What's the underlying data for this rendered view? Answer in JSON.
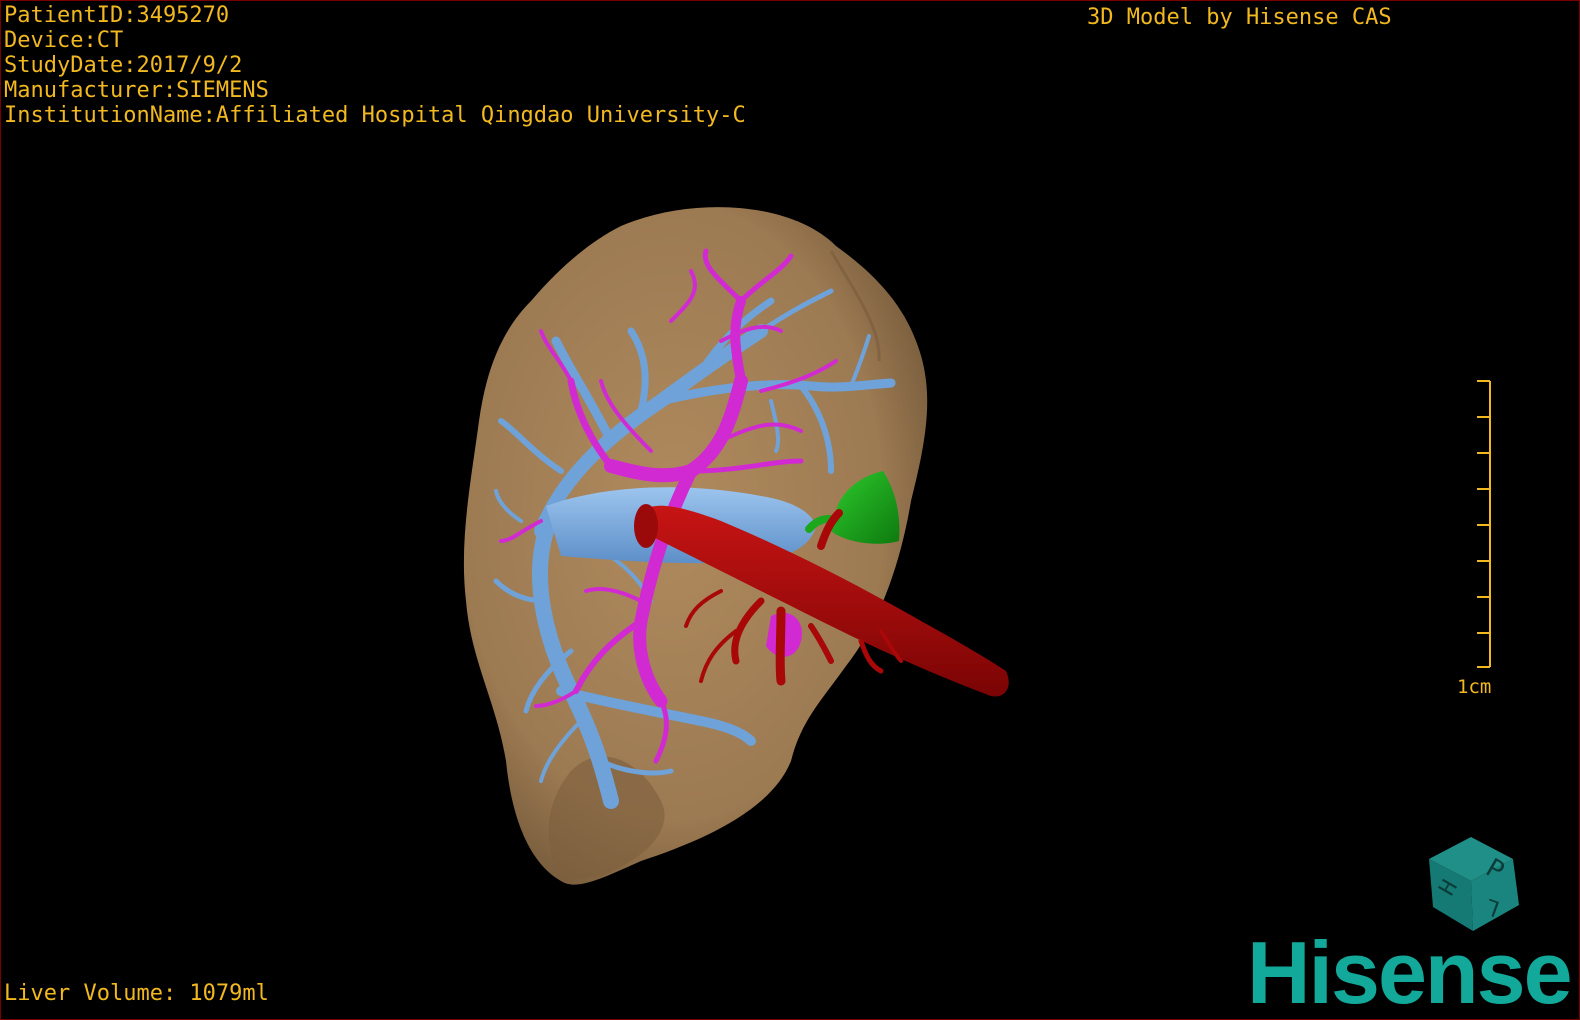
{
  "overlay": {
    "patient_id": "PatientID:3495270",
    "device": "Device:CT",
    "study_date": "StudyDate:2017/9/2",
    "manufacturer": "Manufacturer:SIEMENS",
    "institution": "InstitutionName:Affiliated Hospital Qingdao University-C",
    "credit": "3D Model by Hisense CAS",
    "liver_volume": "Liver Volume: 1079ml"
  },
  "scale_bar": {
    "label": "1cm"
  },
  "orientation_cube": {
    "letters": [
      "P",
      "H",
      "L"
    ]
  },
  "brand": {
    "logo_text": "Hisense"
  },
  "colors": {
    "text": "#f2b820",
    "liver": "#a07c52",
    "portal_vein": "#6fa2d8",
    "hepatic_vein": "#d22ad2",
    "artery": "#b00808",
    "gallbladder": "#1ca81c",
    "brand": "#12a89a"
  },
  "icons": [
    "orientation-cube-icon",
    "hisense-logo"
  ]
}
